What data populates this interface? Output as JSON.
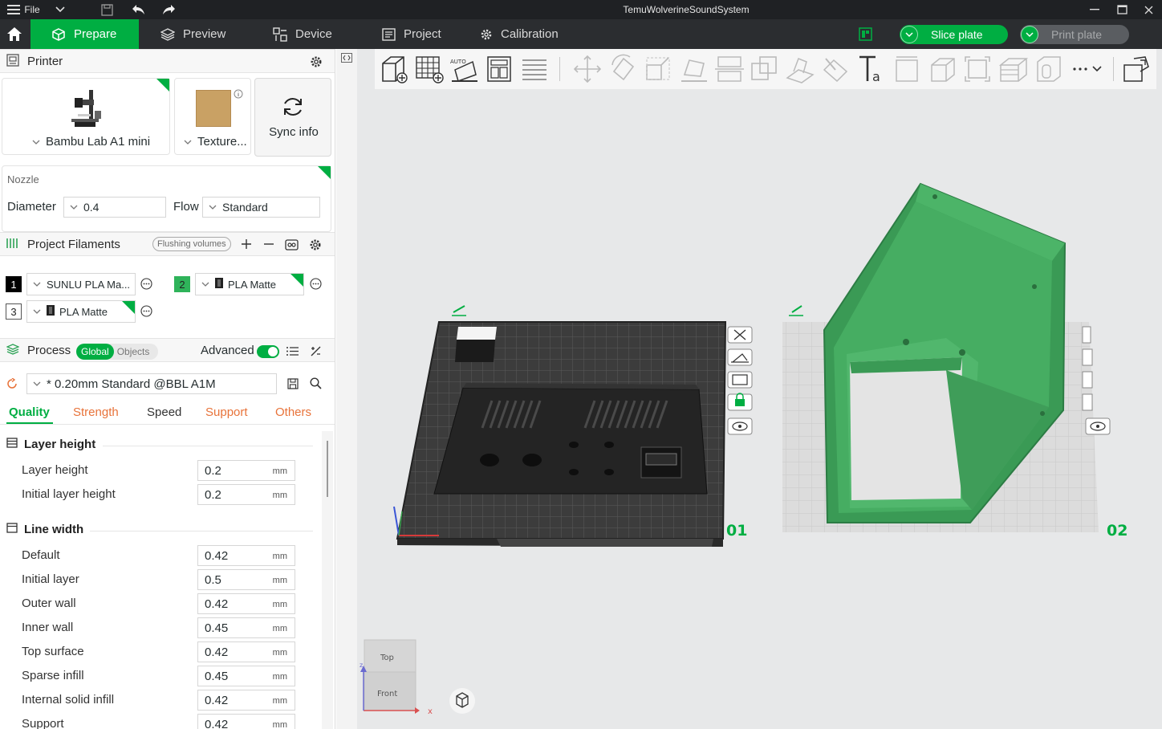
{
  "titlebar": {
    "menu_label": "File",
    "title": "TemuWolverineSoundSystem",
    "icons": [
      "hamburger-icon",
      "chevron-down-icon",
      "save-icon",
      "undo-icon",
      "redo-icon",
      "minimize-icon",
      "maximize-icon",
      "close-icon"
    ]
  },
  "toolbar": {
    "tabs": [
      {
        "label": "Prepare",
        "icon": "cube-icon",
        "active": true
      },
      {
        "label": "Preview",
        "icon": "layers-icon"
      },
      {
        "label": "Device",
        "icon": "device-icon"
      },
      {
        "label": "Project",
        "icon": "project-icon"
      },
      {
        "label": "Calibration",
        "icon": "gear-icon"
      }
    ],
    "slice_label": "Slice plate",
    "print_label": "Print plate"
  },
  "printer": {
    "header": "Printer",
    "name": "Bambu Lab A1 mini",
    "plate": "Texture...",
    "sync_label": "Sync info",
    "nozzle_label": "Nozzle",
    "diameter_label": "Diameter",
    "diameter_value": "0.4",
    "flow_label": "Flow",
    "flow_value": "Standard"
  },
  "filaments": {
    "header": "Project Filaments",
    "flushing_label": "Flushing volumes",
    "items": [
      {
        "index": "1",
        "name": "SUNLU PLA Ma...",
        "color": "#000000"
      },
      {
        "index": "2",
        "name": "PLA Matte",
        "color": "#2fb35a"
      },
      {
        "index": "3",
        "name": "PLA Matte",
        "color": "#ffffff"
      }
    ]
  },
  "process": {
    "header": "Process",
    "scope_global": "Global",
    "scope_objects": "Objects",
    "advanced_label": "Advanced",
    "preset": "* 0.20mm Standard @BBL A1M",
    "tabs": [
      "Quality",
      "Strength",
      "Speed",
      "Support",
      "Others"
    ],
    "groups": [
      {
        "title": "Layer height",
        "rows": [
          {
            "label": "Layer height",
            "value": "0.2",
            "unit": "mm"
          },
          {
            "label": "Initial layer height",
            "value": "0.2",
            "unit": "mm"
          }
        ]
      },
      {
        "title": "Line width",
        "rows": [
          {
            "label": "Default",
            "value": "0.42",
            "unit": "mm"
          },
          {
            "label": "Initial layer",
            "value": "0.5",
            "unit": "mm"
          },
          {
            "label": "Outer wall",
            "value": "0.42",
            "unit": "mm"
          },
          {
            "label": "Inner wall",
            "value": "0.45",
            "unit": "mm"
          },
          {
            "label": "Top surface",
            "value": "0.42",
            "unit": "mm"
          },
          {
            "label": "Sparse infill",
            "value": "0.45",
            "unit": "mm"
          },
          {
            "label": "Internal solid infill",
            "value": "0.42",
            "unit": "mm"
          },
          {
            "label": "Support",
            "value": "0.42",
            "unit": "mm"
          }
        ]
      }
    ]
  },
  "viewport": {
    "plate1_label": "01",
    "plate2_label": "02",
    "cube_top": "Top",
    "cube_front": "Front",
    "axis_x": "x",
    "axis_z": "z",
    "accent": "#00ae42",
    "model_green": "#3a9a55"
  }
}
